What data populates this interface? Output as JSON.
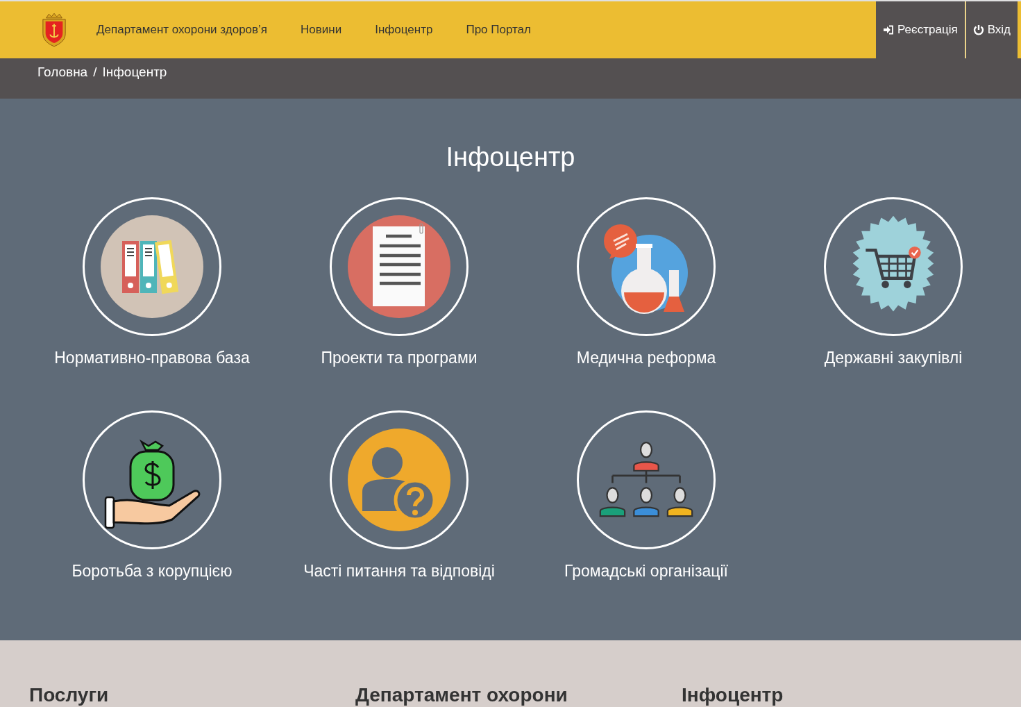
{
  "header": {
    "nav": [
      "Департамент охорони здоров’я",
      "Новини",
      "Інфоцентр",
      "Про Портал"
    ],
    "actions": [
      {
        "kind": "register",
        "label": "Реєстрація"
      },
      {
        "kind": "login",
        "label": "Вхід"
      }
    ]
  },
  "breadcrumb": [
    "Головна",
    "Інфоцентр"
  ],
  "breadcrumb_separator": "/",
  "title": "Інфоцентр",
  "tiles": [
    {
      "kind": "binders",
      "label": "Нормативно-правова база"
    },
    {
      "kind": "document",
      "label": "Проекти та програми"
    },
    {
      "kind": "flasks",
      "label": "Медична реформа"
    },
    {
      "kind": "cart",
      "label": "Державні закупівлі"
    },
    {
      "kind": "money",
      "label": "Боротьба з корупцією"
    },
    {
      "kind": "question",
      "label": "Часті питання та відповіді"
    },
    {
      "kind": "orgchart",
      "label": "Громадські організації"
    }
  ],
  "footer": {
    "headings": [
      "Послуги",
      "Департамент охорони",
      "Інфоцентр"
    ]
  }
}
